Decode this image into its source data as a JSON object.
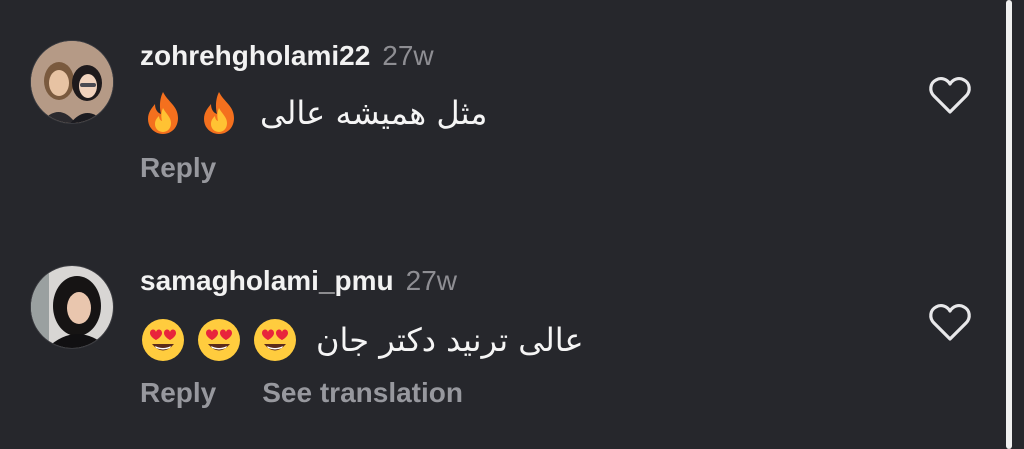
{
  "comments": [
    {
      "username": "zohrehgholami22",
      "time": "27w",
      "text": "مثل همیشه عالی",
      "emojis": [
        "fire-emoji",
        "fire-emoji"
      ],
      "avatar_icon": "profile-photo-two-women",
      "actions": {
        "reply": "Reply"
      },
      "like_icon": "heart-outline-icon"
    },
    {
      "username": "samagholami_pmu",
      "time": "27w",
      "text": "عالی ترنید دکتر جان",
      "emojis": [
        "heart-eyes-emoji",
        "heart-eyes-emoji",
        "heart-eyes-emoji"
      ],
      "avatar_icon": "profile-photo-woman",
      "actions": {
        "reply": "Reply",
        "translate": "See translation"
      },
      "like_icon": "heart-outline-icon"
    }
  ],
  "colors": {
    "background": "#26272c",
    "username": "#f2f2f2",
    "secondary": "#8e8e93",
    "action": "#97989e"
  }
}
